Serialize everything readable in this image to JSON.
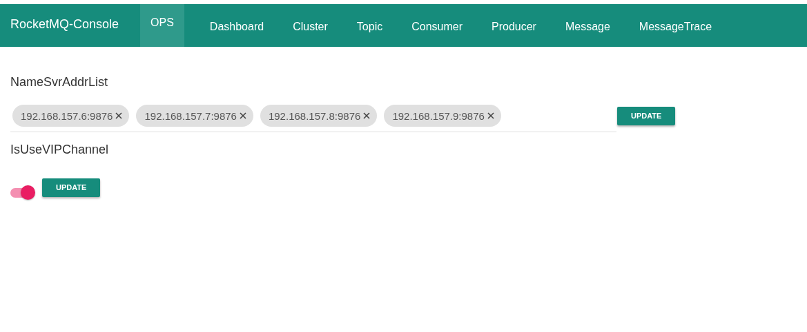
{
  "navbar": {
    "brand": "RocketMQ-Console",
    "tabs": [
      {
        "label": "OPS",
        "selected": true
      },
      {
        "label": "Dashboard",
        "selected": false
      },
      {
        "label": "Cluster",
        "selected": false
      },
      {
        "label": "Topic",
        "selected": false
      },
      {
        "label": "Consumer",
        "selected": false
      },
      {
        "label": "Producer",
        "selected": false
      },
      {
        "label": "Message",
        "selected": false
      },
      {
        "label": "MessageTrace",
        "selected": false
      }
    ]
  },
  "namesrv": {
    "title": "NameSvrAddrList",
    "chips": [
      "192.168.157.6:9876",
      "192.168.157.7:9876",
      "192.168.157.8:9876",
      "192.168.157.9:9876"
    ],
    "button": "UPDATE"
  },
  "vip": {
    "title": "IsUseVIPChannel",
    "on": true,
    "button": "UPDATE"
  }
}
